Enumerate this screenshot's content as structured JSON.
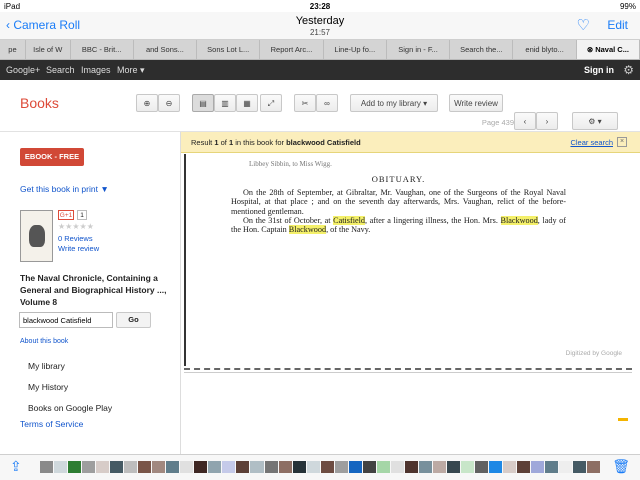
{
  "status": {
    "device": "iPad",
    "time": "23:28",
    "battery": "99%"
  },
  "photos": {
    "back": "Camera Roll",
    "title": "Yesterday",
    "subtitle": "21:57",
    "edit": "Edit"
  },
  "tabs": [
    "pe",
    "Isle of W",
    "BBC - Brit...",
    "and Sons...",
    "Sons Lot L...",
    "Report Arc...",
    "Line-Up fo...",
    "Sign in - F...",
    "Search the...",
    "enid blyto...",
    "Naval C..."
  ],
  "gbar": {
    "items": [
      "Google+",
      "Search",
      "Images",
      "More ▾"
    ],
    "signin": "Sign in"
  },
  "books": {
    "logo": "Books",
    "add_library": "Add to my library",
    "write_review": "Write review",
    "page": "Page 439"
  },
  "sidebar": {
    "ebook": "EBOOK - FREE",
    "print": "Get this book in print ▼",
    "gplus": "G+1",
    "gcount": "1",
    "stars": "★★★★★",
    "reviews": "0 Reviews",
    "write_review": "Write review",
    "title": "The Naval Chronicle, Containing a General and Biographical History ..., Volume 8",
    "search_value": "blackwood Catisfield",
    "go": "Go",
    "about": "About this book",
    "nav": [
      "My library",
      "My History",
      "Books on Google Play"
    ],
    "tos": "Terms of Service"
  },
  "result": {
    "prefix": "Result ",
    "n": "1",
    "of": " of ",
    "total": "1",
    "mid": " in this book for ",
    "query": "blackwood Catisfield",
    "clear": "Clear search"
  },
  "page_text": {
    "top": "Libbey Sibbin, to Miss Wigg.",
    "heading": "OBITUARY.",
    "p1": "On the 28th of September, at Gibraltar, Mr. Vaughan, one of the Surgeons of the Royal Naval Hospital, at that place ; and on the seventh day afterwards, Mrs. Vaughan, relict of the before-mentioned gentleman.",
    "p2a": "On the 31st of October, at ",
    "p2hl1": "Catisfield",
    "p2b": ", after a lingering illness, the Hon. Mrs. ",
    "p2hl2": "Blackwood",
    "p2c": ", lady of the Hon. Captain ",
    "p2hl3": "Blackwood",
    "p2d": ", of the Navy.",
    "digitized": "Digitized by Google"
  },
  "thumb_colors": [
    "#8a8a8a",
    "#cfd8dc",
    "#2e7d32",
    "#9e9e9e",
    "#d7ccc8",
    "#455a64",
    "#bdbdbd",
    "#795548",
    "#a1887f",
    "#607d8b",
    "#e0e0e0",
    "#3e2723",
    "#90a4ae",
    "#c5cae9",
    "#5d4037",
    "#b0bec5",
    "#757575",
    "#8d6e63",
    "#263238",
    "#cfd8dc",
    "#6d4c41",
    "#9e9e9e",
    "#1565c0",
    "#424242",
    "#a5d6a7",
    "#e0e0e0",
    "#4e342e",
    "#78909c",
    "#bcaaa4",
    "#37474f",
    "#c8e6c9",
    "#616161",
    "#1e88e5",
    "#d7ccc8",
    "#5d4037",
    "#9fa8da",
    "#607d8b",
    "#eeeeee",
    "#455a64",
    "#8d6e63"
  ]
}
